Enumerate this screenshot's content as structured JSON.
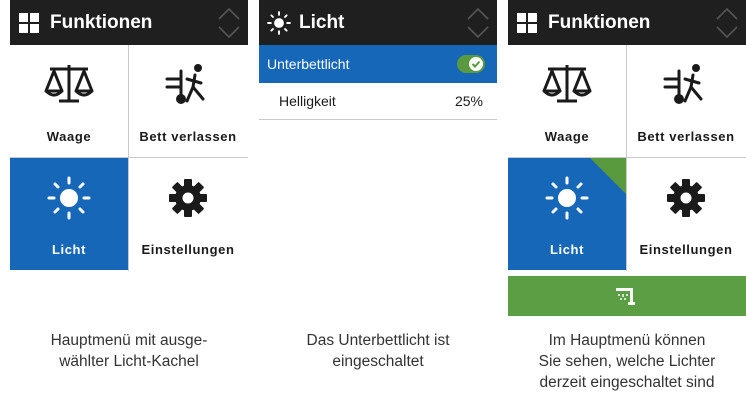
{
  "colors": {
    "header_bg": "#1f1f1f",
    "selected_blue": "#1767b8",
    "toggle_green": "#5a9a3e",
    "status_green": "#5c9e44",
    "divider": "#c9c9c9"
  },
  "panel1": {
    "header": {
      "icon": "grid-icon",
      "title": "Funktionen"
    },
    "tiles": [
      {
        "icon": "scale-icon",
        "label": "Waage",
        "selected": false
      },
      {
        "icon": "bed-exit-icon",
        "label": "Bett verlassen",
        "selected": false
      },
      {
        "icon": "sun-icon",
        "label": "Licht",
        "selected": true
      },
      {
        "icon": "gear-icon",
        "label": "Einstellungen",
        "selected": false
      }
    ],
    "caption": [
      "Hauptmenü mit ausge-",
      "wählter Licht-Kachel"
    ]
  },
  "panel2": {
    "header": {
      "icon": "sun-icon",
      "title": "Licht"
    },
    "rows": [
      {
        "label": "Unterbettlicht",
        "toggle": "on",
        "selected": true
      },
      {
        "label": "Helligkeit",
        "value": "25%",
        "selected": false
      }
    ],
    "caption": [
      "Das Unterbettlicht ist",
      "eingeschaltet"
    ]
  },
  "panel3": {
    "header": {
      "icon": "grid-icon",
      "title": "Funktionen"
    },
    "tiles": [
      {
        "icon": "scale-icon",
        "label": "Waage",
        "selected": false
      },
      {
        "icon": "bed-exit-icon",
        "label": "Bett verlassen",
        "selected": false
      },
      {
        "icon": "sun-icon",
        "label": "Licht",
        "selected": true,
        "indicator": "light-on-corner"
      },
      {
        "icon": "gear-icon",
        "label": "Einstellungen",
        "selected": false
      }
    ],
    "status_bar": {
      "icon": "underbed-light-icon"
    },
    "caption": [
      "Im Hauptmenü können",
      "Sie sehen, welche Lichter",
      "derzeit eingeschaltet sind"
    ]
  }
}
